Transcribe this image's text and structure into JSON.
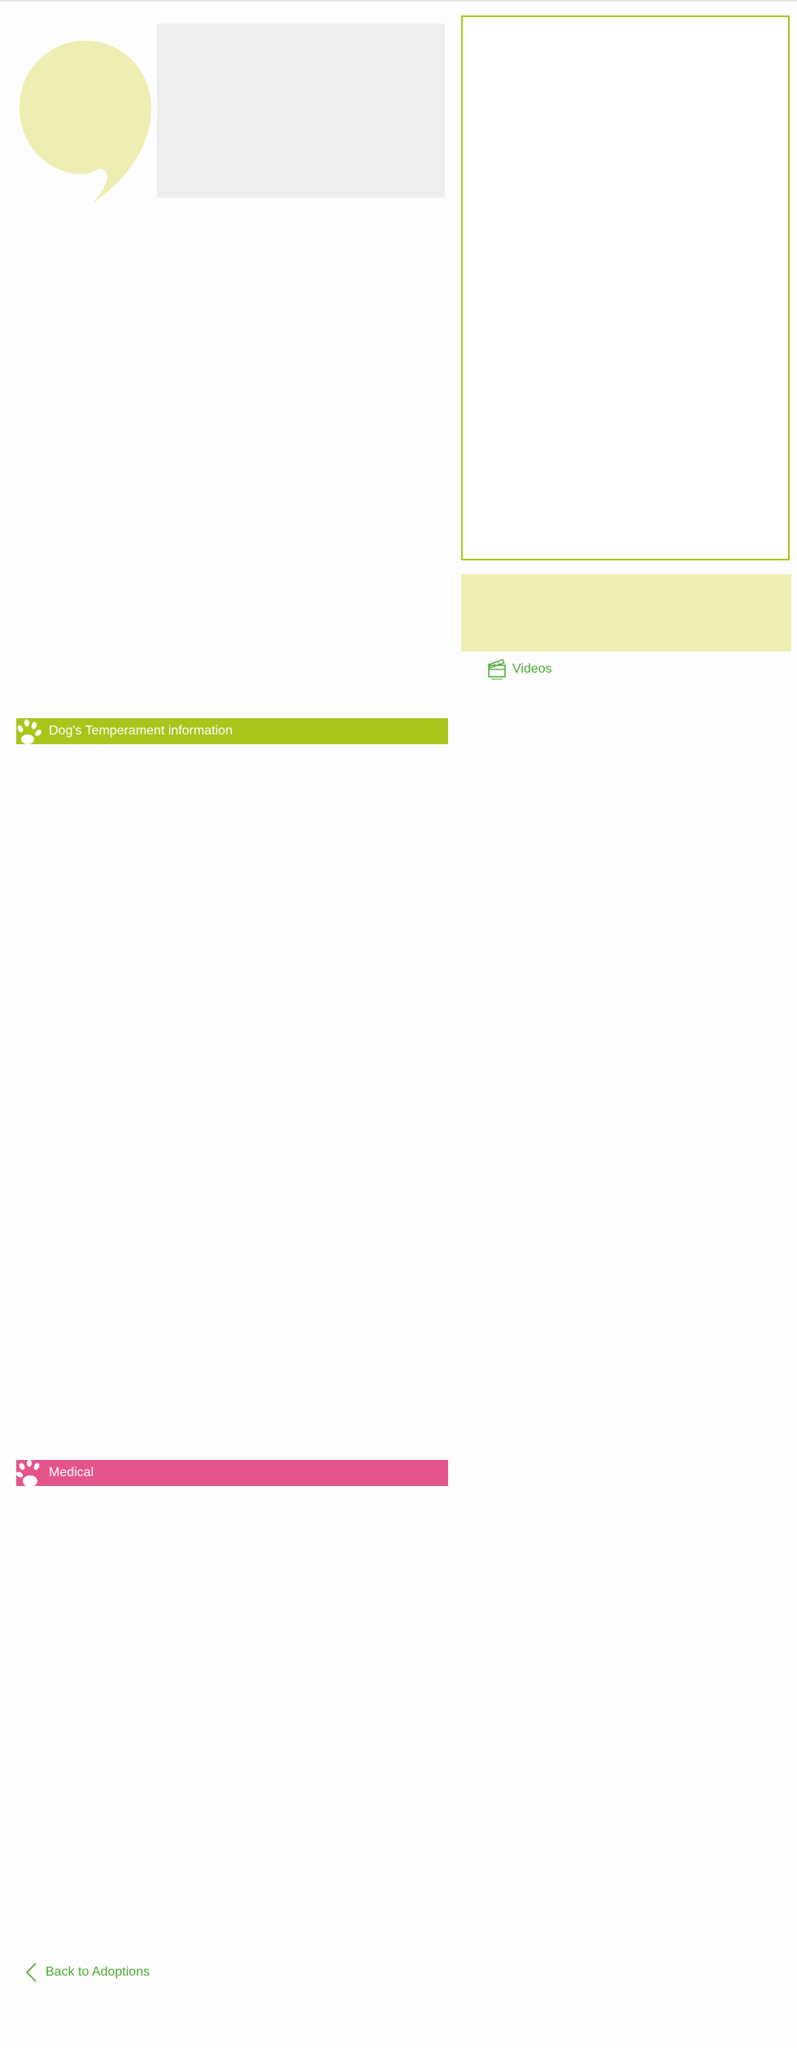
{
  "colors": {
    "accent_green": "#a9c51c",
    "link_green": "#4aa832",
    "quote_yellow": "#eeeeb3",
    "medical_pink": "#e4548a",
    "placeholder_grey": "#eeeeee"
  },
  "icons": {
    "quote": "quote-mark-icon",
    "video": "film-clapper-icon",
    "paw": "paw-print-icon",
    "back": "chevron-left-icon"
  },
  "media": {
    "videos_label": "Videos"
  },
  "sections": {
    "temperament": {
      "title": "Dog's Temperament information"
    },
    "medical": {
      "title": "Medical"
    }
  },
  "navigation": {
    "back_label": "Back to Adoptions"
  }
}
